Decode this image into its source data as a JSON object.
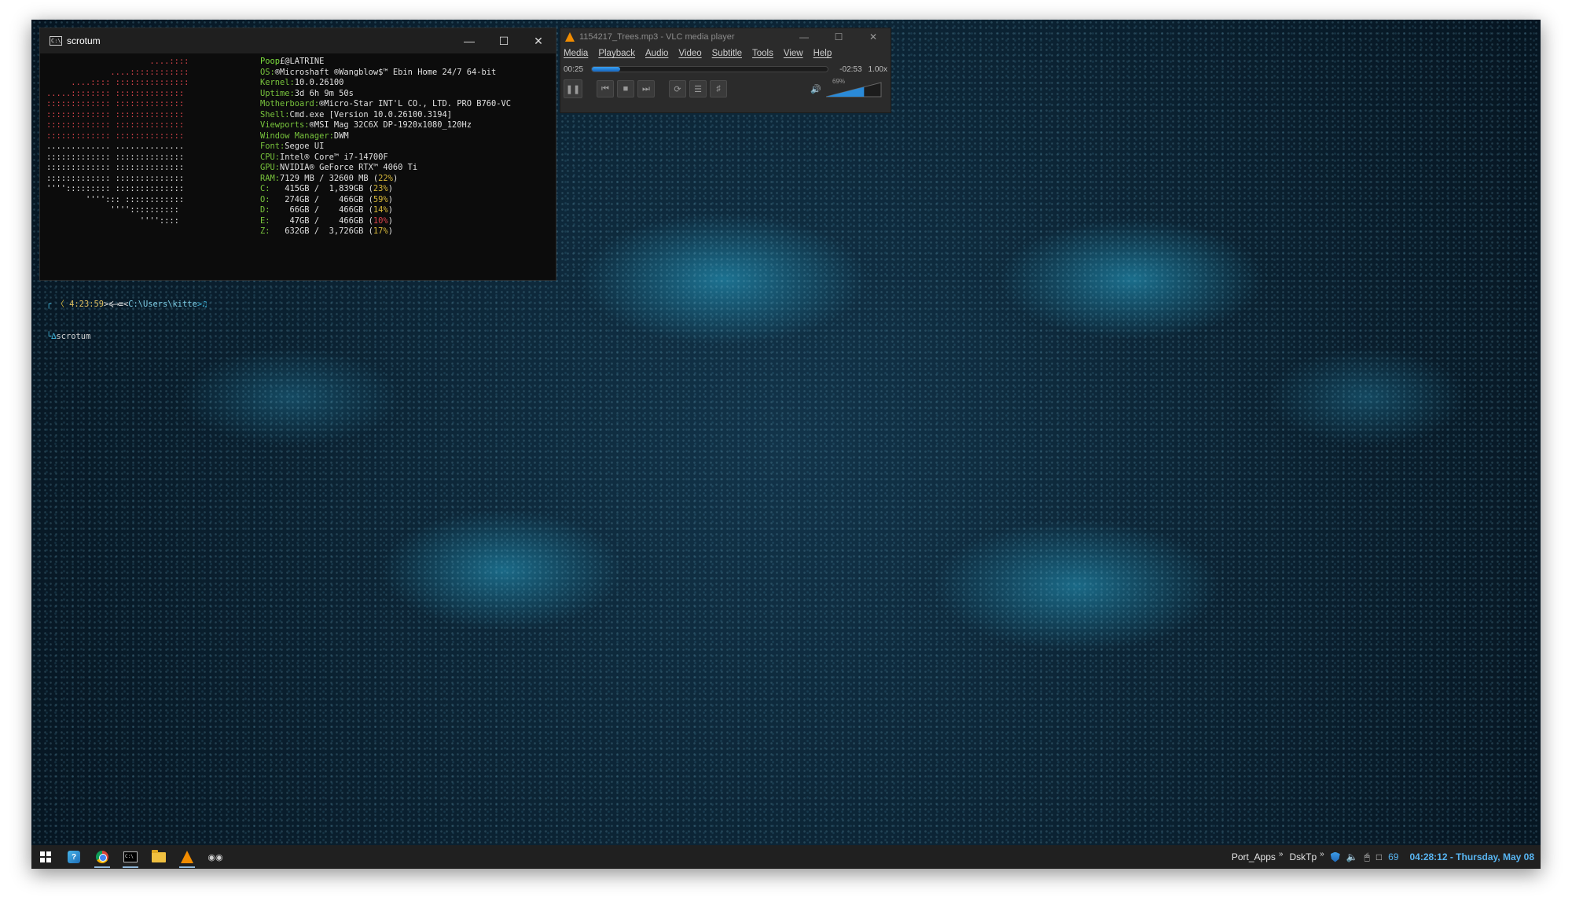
{
  "terminal": {
    "title": "scrotum",
    "icon_text": "C:\\",
    "logo_lines": [
      {
        "text": "                     ....::::",
        "color": "c-r"
      },
      {
        "text": "             ....::::::::::::",
        "color": "c-r"
      },
      {
        "text": "     ....:::: :::::::::::::::",
        "color": "c-r"
      },
      {
        "text": ".....:::::::: ::::::::::::::",
        "color": "c-r"
      },
      {
        "text": "::::::::::::: ::::::::::::::",
        "color": "c-r"
      },
      {
        "text": "::::::::::::: ::::::::::::::",
        "color": "c-r"
      },
      {
        "text": "::::::::::::: ::::::::::::::",
        "color": "c-r"
      },
      {
        "text": "::::::::::::: ::::::::::::::",
        "color": "c-r"
      },
      {
        "text": "............. ..............",
        "color": "c-w"
      },
      {
        "text": "::::::::::::: ::::::::::::::",
        "color": "c-w"
      },
      {
        "text": "::::::::::::: ::::::::::::::",
        "color": "c-w"
      },
      {
        "text": "::::::::::::: ::::::::::::::",
        "color": "c-w"
      },
      {
        "text": "''''::::::::: ::::::::::::::",
        "color": "c-w"
      },
      {
        "text": "        ''''::: ::::::::::::",
        "color": "c-w"
      },
      {
        "text": "             ''''::::::::::",
        "color": "c-w"
      },
      {
        "text": "                   ''''::::",
        "color": "c-w"
      }
    ],
    "info_lines": [
      {
        "key": "Poop",
        "val": "£@LATRINE"
      },
      {
        "key": "OS:",
        "val": "®Microshaft ®Wangblow$™ Ebin Home 24/7 64-bit"
      },
      {
        "key": "Kernel:",
        "val": "10.0.26100"
      },
      {
        "key": "Uptime:",
        "val": "3d 6h 9m 50s"
      },
      {
        "key": "Motherboard:",
        "val": "®Micro-Star INT'L CO., LTD. PRO B760-VC"
      },
      {
        "key": "Shell:",
        "val": "Cmd.exe [Version 10.0.26100.3194]"
      },
      {
        "key": "Viewports:",
        "val": "®MSI Mag 32C6X DP-1920x1080_120Hz"
      },
      {
        "key": "Window Manager:",
        "val": "DWM"
      },
      {
        "key": "Font:",
        "val": "Segoe UI"
      },
      {
        "key": "CPU:",
        "val": "Intel® Core™ i7-14700F"
      },
      {
        "key": "GPU:",
        "val": "NVIDIA® GeForce RTX™ 4060 Ti"
      },
      {
        "key": "RAM:",
        "val": "7129 MB / 32600 MB ",
        "pct": "22%",
        "pct_color": "c-y"
      },
      {
        "key": "C:",
        "val": "   415GB /  1,839GB ",
        "pct": "23%",
        "pct_color": "c-y"
      },
      {
        "key": "O:",
        "val": "   274GB /    466GB ",
        "pct": "59%",
        "pct_color": "c-y"
      },
      {
        "key": "D:",
        "val": "    66GB /    466GB ",
        "pct": "14%",
        "pct_color": "c-y"
      },
      {
        "key": "E:",
        "val": "    47GB /    466GB ",
        "pct": "10%",
        "pct_color": "c-r"
      },
      {
        "key": "Z:",
        "val": "   632GB /  3,726GB ",
        "pct": "17%",
        "pct_color": "c-y"
      }
    ],
    "prompt": {
      "time": "4:23:59",
      "path": "C:\\Users\\kitte",
      "command": "scrotum"
    }
  },
  "vlc": {
    "title": "1154217_Trees.mp3 - VLC media player",
    "menu": [
      "Media",
      "Playback",
      "Audio",
      "Video",
      "Subtitle",
      "Tools",
      "View",
      "Help"
    ],
    "elapsed": "00:25",
    "remaining": "-02:53",
    "speed": "1.00x",
    "progress": 0.12,
    "volume_percent": "69%",
    "volume": 0.69
  },
  "taskbar": {
    "toolbars": [
      "Port_Apps",
      "DskTp"
    ],
    "tray_number": "69",
    "clock": "04:28:12 - Thursday, May 08"
  }
}
